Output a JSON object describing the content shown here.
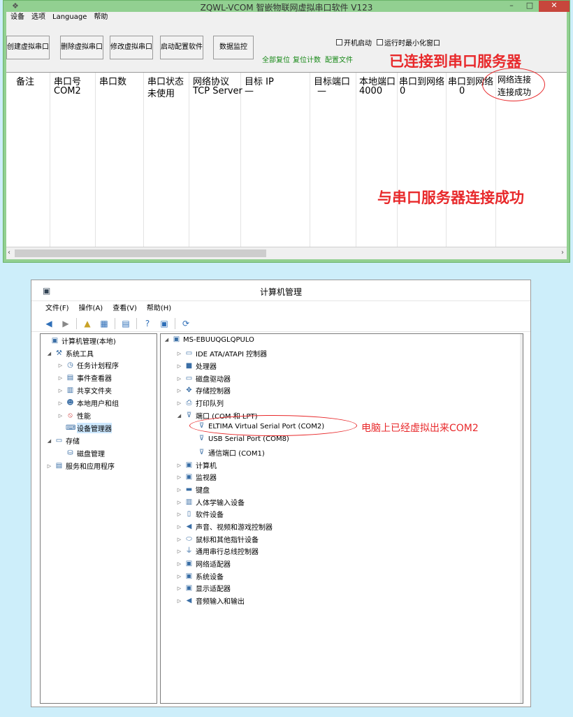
{
  "vcom": {
    "title": "ZQWL-VCOM 智嵌物联网虚拟串口软件 V123",
    "menu": [
      "设备",
      "选项",
      "Language",
      "帮助"
    ],
    "buttons": [
      "创建虚拟串口",
      "删除虚拟串口",
      "修改虚拟串口",
      "启动配置软件",
      "数据监控"
    ],
    "checkbox_autostart": "开机启动",
    "checkbox_minimize": "运行时最小化窗口",
    "links": [
      "全部复位",
      "复位计数",
      "配置文件"
    ],
    "columns": [
      "备注",
      "串口号",
      "串口数",
      "串口状态",
      "网络协议",
      "目标 IP",
      "目标端口",
      "本地端口",
      "串口到网络",
      "串口到网络",
      "网络连接"
    ],
    "row": {
      "port": "COM2",
      "status": "未使用",
      "protocol": "TCP Server",
      "target_ip": "—",
      "target_port": "—",
      "local_port": "4000",
      "tx1": "0",
      "tx2": "0",
      "net_state": "连接成功"
    }
  },
  "annotations": {
    "connected": "已连接到串口服务器",
    "success": "与串口服务器连接成功",
    "virtual": "电脑上已经虚拟出来COM2"
  },
  "cm": {
    "title": "计算机管理",
    "menu": [
      "文件(F)",
      "操作(A)",
      "查看(V)",
      "帮助(H)"
    ],
    "left_tree": [
      "计算机管理(本地)",
      "系统工具",
      "任务计划程序",
      "事件查看器",
      "共享文件夹",
      "本地用户和组",
      "性能",
      "设备管理器",
      "存储",
      "磁盘管理",
      "服务和应用程序"
    ],
    "computer": "MS-EBUUQGLQPULO",
    "devices": [
      "IDE ATA/ATAPI 控制器",
      "处理器",
      "磁盘驱动器",
      "存储控制器",
      "打印队列",
      "端口 (COM 和 LPT)",
      "ELTIMA Virtual Serial Port (COM2)",
      "USB Serial Port (COM8)",
      "通信端口 (COM1)",
      "计算机",
      "监视器",
      "键盘",
      "人体学输入设备",
      "软件设备",
      "声音、视频和游戏控制器",
      "鼠标和其他指针设备",
      "通用串行总线控制器",
      "网络适配器",
      "系统设备",
      "显示适配器",
      "音频输入和输出"
    ]
  },
  "colors": {
    "accent_red": "#e8292b",
    "frame_green": "#92d091"
  }
}
